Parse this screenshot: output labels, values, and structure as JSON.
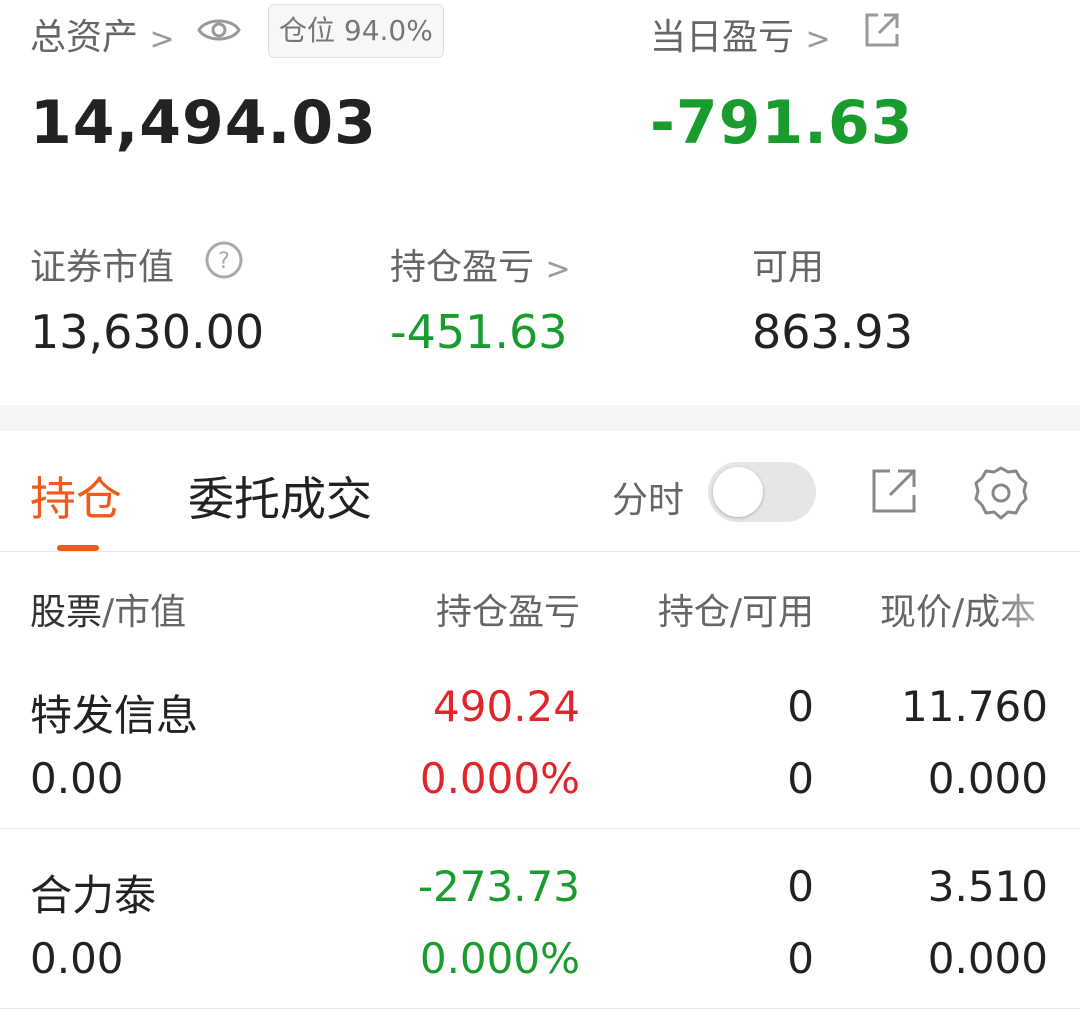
{
  "summary": {
    "total_assets_label": "总资产",
    "position_badge": "仓位 94.0%",
    "total_assets_value": "14,494.03",
    "daily_pnl_label": "当日盈亏",
    "daily_pnl_value": "-791.63",
    "securities_value_label": "证券市值",
    "securities_value": "13,630.00",
    "holding_pnl_label": "持仓盈亏",
    "holding_pnl_value": "-451.63",
    "available_label": "可用",
    "available_value": "863.93"
  },
  "tabs": [
    {
      "label": "持仓",
      "active": true
    },
    {
      "label": "委托成交",
      "active": false
    }
  ],
  "toolbar": {
    "timeshare_label": "分时",
    "timeshare_on": false
  },
  "table": {
    "headers": {
      "stock": "股票",
      "market_value": "/市值",
      "pnl": "持仓盈亏",
      "hold_avail": "持仓/可用",
      "price_cost": "现价/成本"
    },
    "rows": [
      {
        "name": "特发信息",
        "market_value": "0.00",
        "pnl": "490.24",
        "pnl_pct": "0.000%",
        "hold": "0",
        "avail": "0",
        "price": "11.760",
        "cost": "0.000",
        "trend": "up"
      },
      {
        "name": "合力泰",
        "market_value": "0.00",
        "pnl": "-273.73",
        "pnl_pct": "0.000%",
        "hold": "0",
        "avail": "0",
        "price": "3.510",
        "cost": "0.000",
        "trend": "down"
      }
    ]
  },
  "colors": {
    "accent": "#f05a1a",
    "gain": "#e0262b",
    "loss": "#1a9b2e"
  },
  "icons": [
    "eye-icon",
    "external-link-icon",
    "help-circle-icon",
    "chevron-right-icon",
    "gear-icon"
  ]
}
